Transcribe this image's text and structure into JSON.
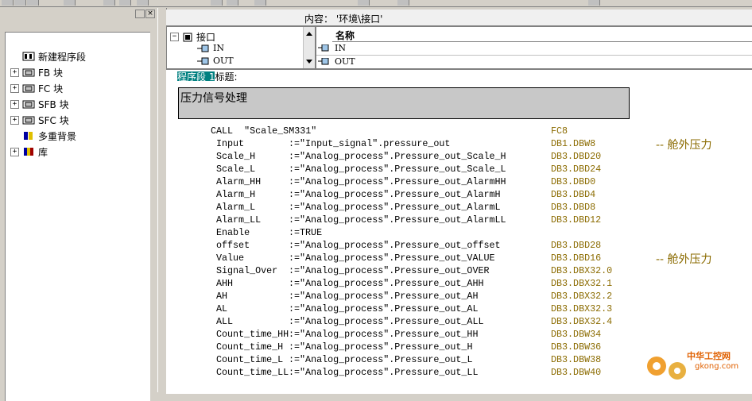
{
  "content_header": {
    "label": "内容： '环境\\接口'"
  },
  "tree": [
    {
      "label": "新建程序段",
      "icon": "network-icon",
      "expandable": false
    },
    {
      "label": "FB 块",
      "icon": "fb-block-icon",
      "expandable": true
    },
    {
      "label": "FC 块",
      "icon": "fc-block-icon",
      "expandable": true
    },
    {
      "label": "SFB 块",
      "icon": "sfb-block-icon",
      "expandable": true
    },
    {
      "label": "SFC 块",
      "icon": "sfc-block-icon",
      "expandable": true
    },
    {
      "label": "多重背景",
      "icon": "multi-instance-icon",
      "expandable": false
    },
    {
      "label": "库",
      "icon": "library-icon",
      "expandable": true
    }
  ],
  "interface_tree": {
    "root": "接口",
    "children": [
      "IN",
      "OUT"
    ]
  },
  "names_table": {
    "header": "名称",
    "rows": [
      "IN",
      "OUT"
    ]
  },
  "network": {
    "title_prefix": "程序段 1",
    "title_suffix": "标题:",
    "comment_box": "压力信号处理"
  },
  "call": {
    "statement": "CALL  \"Scale_SM331\"",
    "address": "FC8"
  },
  "params": [
    {
      "name": "Input",
      "assign": ":=\"Input_signal\".pressure_out",
      "address": "DB1.DBW8",
      "comment": "-- 舱外压力"
    },
    {
      "name": "Scale_H",
      "assign": ":=\"Analog_process\".Pressure_out_Scale_H",
      "address": "DB3.DBD20",
      "comment": ""
    },
    {
      "name": "Scale_L",
      "assign": ":=\"Analog_process\".Pressure_out_Scale_L",
      "address": "DB3.DBD24",
      "comment": ""
    },
    {
      "name": "Alarm_HH",
      "assign": ":=\"Analog_process\".Pressure_out_AlarmHH",
      "address": "DB3.DBD0",
      "comment": ""
    },
    {
      "name": "Alarm_H",
      "assign": ":=\"Analog_process\".Pressure_out_AlarmH",
      "address": "DB3.DBD4",
      "comment": ""
    },
    {
      "name": "Alarm_L",
      "assign": ":=\"Analog_process\".Pressure_out_AlarmL",
      "address": "DB3.DBD8",
      "comment": ""
    },
    {
      "name": "Alarm_LL",
      "assign": ":=\"Analog_process\".Pressure_out_AlarmLL",
      "address": "DB3.DBD12",
      "comment": ""
    },
    {
      "name": "Enable",
      "assign": ":=TRUE",
      "address": "",
      "comment": ""
    },
    {
      "name": "offset",
      "assign": ":=\"Analog_process\".Pressure_out_offset",
      "address": "DB3.DBD28",
      "comment": ""
    },
    {
      "name": "Value",
      "assign": ":=\"Analog_process\".Pressure_out_VALUE",
      "address": "DB3.DBD16",
      "comment": "-- 舱外压力"
    },
    {
      "name": "Signal_Over",
      "assign": ":=\"Analog_process\".Pressure_out_OVER",
      "address": "DB3.DBX32.0",
      "comment": ""
    },
    {
      "name": "AHH",
      "assign": ":=\"Analog_process\".Pressure_out_AHH",
      "address": "DB3.DBX32.1",
      "comment": ""
    },
    {
      "name": "AH",
      "assign": ":=\"Analog_process\".Pressure_out_AH",
      "address": "DB3.DBX32.2",
      "comment": ""
    },
    {
      "name": "AL",
      "assign": ":=\"Analog_process\".Pressure_out_AL",
      "address": "DB3.DBX32.3",
      "comment": ""
    },
    {
      "name": "ALL",
      "assign": ":=\"Analog_process\".Pressure_out_ALL",
      "address": "DB3.DBX32.4",
      "comment": ""
    },
    {
      "name": "Count_time_HH",
      "assign": ":=\"Analog_process\".Pressure_out_HH",
      "address": "DB3.DBW34",
      "comment": ""
    },
    {
      "name": "Count_time_H",
      "assign": " :=\"Analog_process\".Pressure_out_H",
      "address": "DB3.DBW36",
      "comment": ""
    },
    {
      "name": "Count_time_L",
      "assign": " :=\"Analog_process\".Pressure_out_L",
      "address": "DB3.DBW38",
      "comment": ""
    },
    {
      "name": "Count_time_LL",
      "assign": ":=\"Analog_process\".Pressure_out_LL",
      "address": "DB3.DBW40",
      "comment": ""
    }
  ],
  "watermark": {
    "line1": "中华工控网",
    "line2": "gkong.com"
  }
}
